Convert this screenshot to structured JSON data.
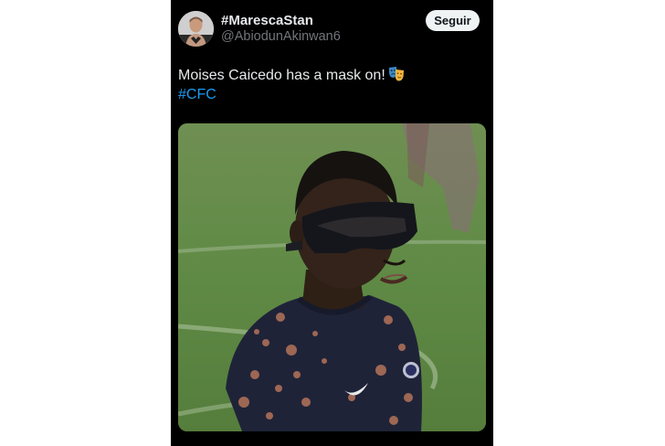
{
  "tweet": {
    "display_name": "#MarescaStan",
    "handle": "@AbiodunAkinwan6",
    "follow_label": "Seguir",
    "text": "Moises Caicedo has a mask on!",
    "emoji_icon": "performing-arts-icon",
    "hashtag": "#CFC"
  },
  "colors": {
    "background": "#000000",
    "text": "#e7e9ea",
    "muted": "#71767b",
    "link": "#1d9bf0",
    "button_bg": "#eff3f4"
  }
}
